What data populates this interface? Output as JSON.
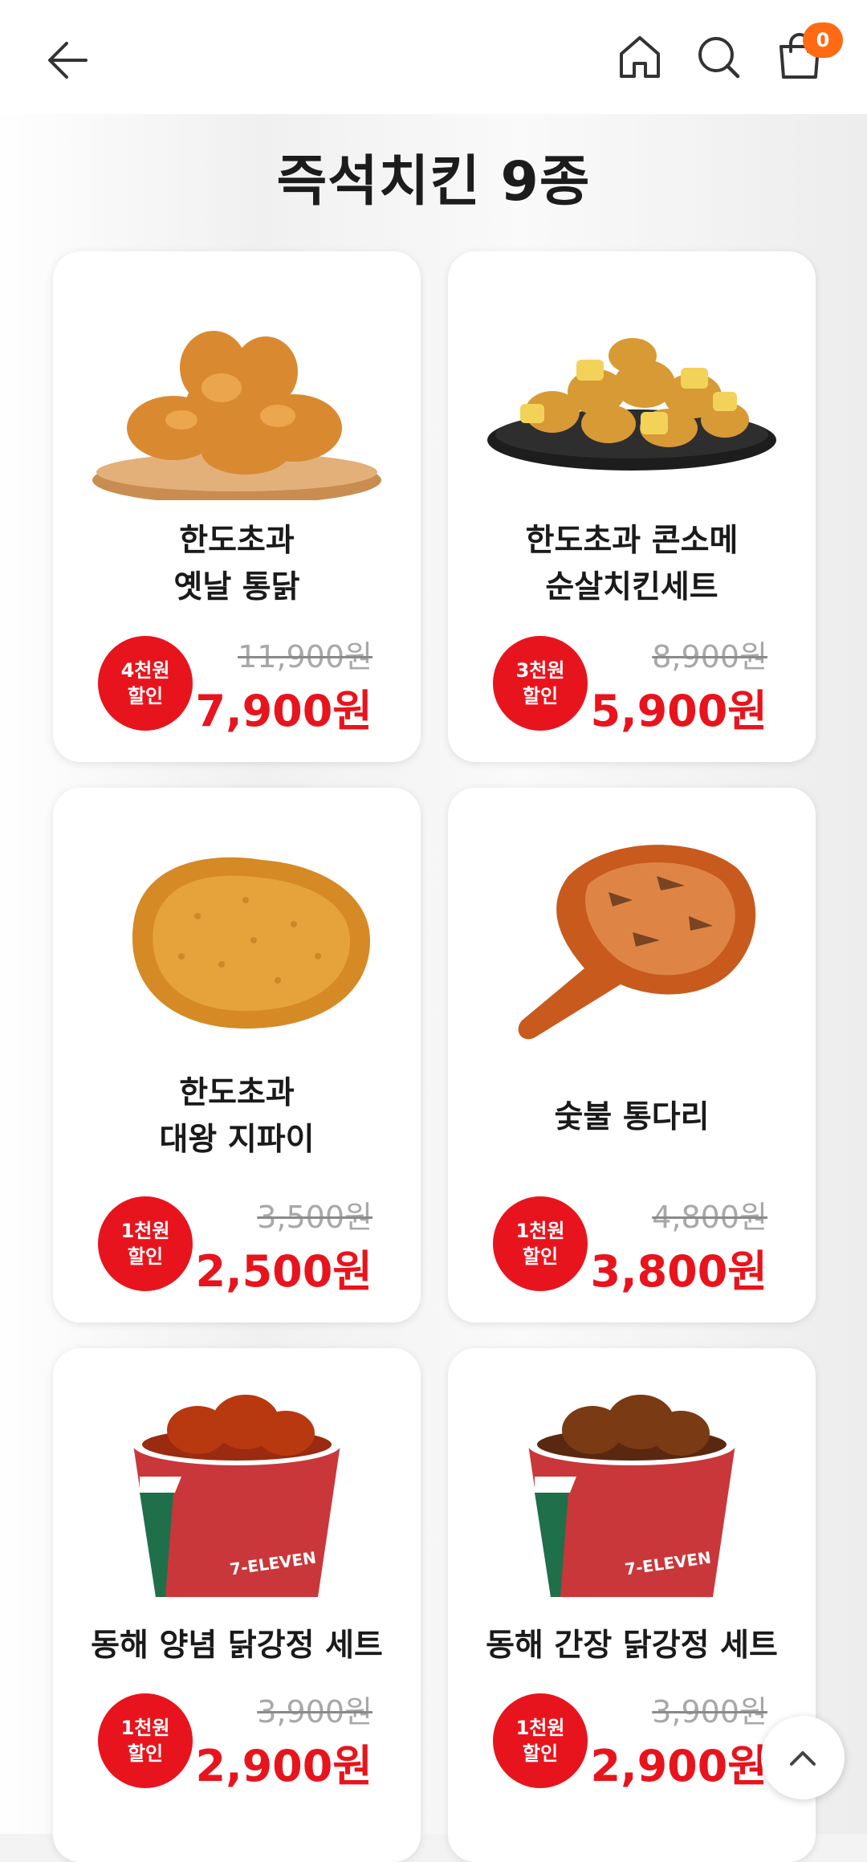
{
  "header": {
    "back_icon": "arrow-left-icon",
    "home_icon": "home-icon",
    "search_icon": "search-icon",
    "cart_icon": "shopping-bag-icon",
    "cart_count": "0"
  },
  "page": {
    "title": "즉석치킨 9종"
  },
  "colors": {
    "accent": "#e8141d",
    "badge_orange": "#ff6a13"
  },
  "products": [
    {
      "name_line1": "한도초과",
      "name_line2": "옛날 통닭",
      "discount_line1": "4천원",
      "discount_line2": "할인",
      "original_price": "11,900원",
      "sale_price": "7,900원"
    },
    {
      "name_line1": "한도초과 콘소메",
      "name_line2": "순살치킨세트",
      "discount_line1": "3천원",
      "discount_line2": "할인",
      "original_price": "8,900원",
      "sale_price": "5,900원"
    },
    {
      "name_line1": "한도초과",
      "name_line2": "대왕 지파이",
      "discount_line1": "1천원",
      "discount_line2": "할인",
      "original_price": "3,500원",
      "sale_price": "2,500원"
    },
    {
      "name_line1": "숯불 통다리",
      "name_line2": "",
      "discount_line1": "1천원",
      "discount_line2": "할인",
      "original_price": "4,800원",
      "sale_price": "3,800원"
    },
    {
      "name_line1": "동해 양념 닭강정 세트",
      "name_line2": "",
      "discount_line1": "1천원",
      "discount_line2": "할인",
      "original_price": "3,900원",
      "sale_price": "2,900원"
    },
    {
      "name_line1": "동해 간장 닭강정 세트",
      "name_line2": "",
      "discount_line1": "1천원",
      "discount_line2": "할인",
      "original_price": "3,900원",
      "sale_price": "2,900원"
    }
  ],
  "cup_logo": "7-ELEVEN",
  "scroll_top_icon": "chevron-up-icon"
}
